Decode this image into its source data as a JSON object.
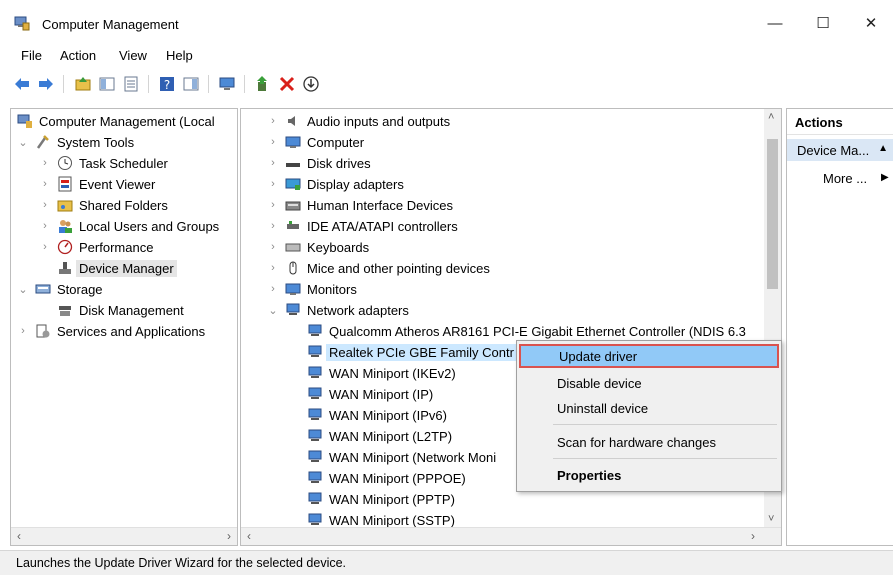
{
  "window": {
    "title": "Computer Management"
  },
  "menu": [
    "File",
    "Action",
    "View",
    "Help"
  ],
  "tree": {
    "root": "Computer Management (Local",
    "system_tools": "System Tools",
    "task_scheduler": "Task Scheduler",
    "event_viewer": "Event Viewer",
    "shared_folders": "Shared Folders",
    "local_users": "Local Users and Groups",
    "performance": "Performance",
    "device_manager": "Device Manager",
    "storage": "Storage",
    "disk_management": "Disk Management",
    "services_apps": "Services and Applications"
  },
  "devices": {
    "categories": [
      "Audio inputs and outputs",
      "Computer",
      "Disk drives",
      "Display adapters",
      "Human Interface Devices",
      "IDE ATA/ATAPI controllers",
      "Keyboards",
      "Mice and other pointing devices",
      "Monitors",
      "Network adapters"
    ],
    "adapters": [
      "Qualcomm Atheros AR8161 PCI-E Gigabit Ethernet Controller (NDIS 6.3",
      "Realtek PCIe GBE Family Contr",
      "WAN Miniport (IKEv2)",
      "WAN Miniport (IP)",
      "WAN Miniport (IPv6)",
      "WAN Miniport (L2TP)",
      "WAN Miniport (Network Moni",
      "WAN Miniport (PPPOE)",
      "WAN Miniport (PPTP)",
      "WAN Miniport (SSTP)"
    ]
  },
  "actions": {
    "header": "Actions",
    "section": "Device Ma...",
    "more": "More ..."
  },
  "context_menu": {
    "update": "Update driver",
    "disable": "Disable device",
    "uninstall": "Uninstall device",
    "scan": "Scan for hardware changes",
    "properties": "Properties"
  },
  "status": {
    "text": "Launches the Update Driver Wizard for the selected device."
  },
  "colors": {
    "selection": "#cce8ff",
    "menu_highlight": "#91c9f7",
    "highlight_border": "#d9534f",
    "delete_red": "#d9201a"
  }
}
